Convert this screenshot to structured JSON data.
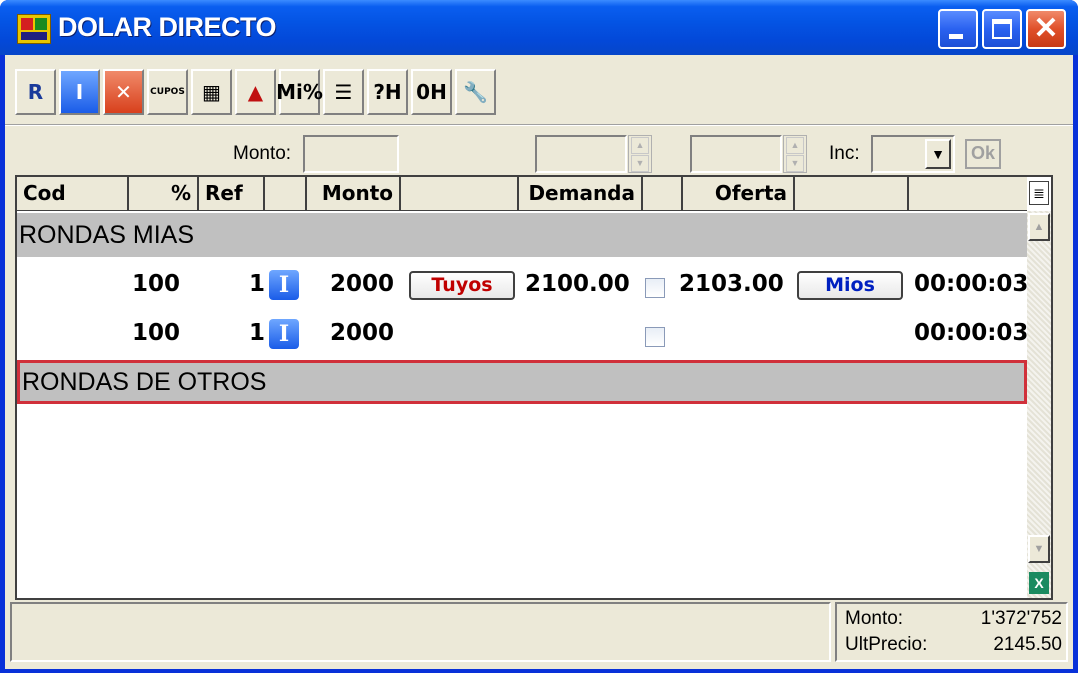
{
  "window": {
    "title": "DOLAR DIRECTO",
    "controls": {
      "minimize": "minimize-icon",
      "maximize": "maximize-icon",
      "close": "close-icon"
    }
  },
  "toolbar": {
    "buttons": [
      {
        "name": "tool-new-round-button",
        "icon": "new-round-icon",
        "glyph": "R",
        "color": "#1a3a9a"
      },
      {
        "name": "tool-info-button",
        "icon": "info-icon",
        "glyph": "I",
        "color": "#ffffff"
      },
      {
        "name": "tool-cancel-button",
        "icon": "cancel-icon",
        "glyph": "✕",
        "color": "#ffffff"
      },
      {
        "name": "tool-cupos-button",
        "icon": "cupos-icon",
        "glyph": "CUPOS",
        "color": "#000000"
      },
      {
        "name": "tool-tables-button",
        "icon": "tables-icon",
        "glyph": "▦",
        "color": "#000000"
      },
      {
        "name": "tool-chart-button",
        "icon": "chart-icon",
        "glyph": "▲",
        "color": "#c01010"
      },
      {
        "name": "tool-mi-percent-button",
        "icon": "mi-percent-icon",
        "glyph": "Mi%",
        "color": "#000000"
      },
      {
        "name": "tool-list-button",
        "icon": "list-icon",
        "glyph": "☰",
        "color": "#000000"
      },
      {
        "name": "tool-help-h-button",
        "icon": "help-h-icon",
        "glyph": "?H",
        "color": "#000000"
      },
      {
        "name": "tool-zero-h-button",
        "icon": "zero-h-icon",
        "glyph": "0H",
        "color": "#000000"
      },
      {
        "name": "tool-settings-button",
        "icon": "wrench-icon",
        "glyph": "🔧",
        "color": "#000000"
      }
    ]
  },
  "inputs": {
    "monto_label": "Monto:",
    "monto_value": "",
    "demanda_value": "",
    "oferta_value": "",
    "inc_label": "Inc:",
    "inc_value": "",
    "ok_label": "Ok"
  },
  "columns": [
    "Cod",
    "%",
    "Ref",
    "",
    "Monto",
    "",
    "Demanda",
    "",
    "Oferta",
    "",
    ""
  ],
  "sections": {
    "mias": "RONDAS MIAS",
    "otros": "RONDAS DE OTROS"
  },
  "rows_mias": [
    {
      "pct": "100",
      "ref": "1",
      "icon": "I",
      "monto": "2000",
      "btn_left": "Tuyos",
      "demanda": "2100.00",
      "checked": false,
      "oferta": "2103.00",
      "btn_right": "Mios",
      "time": "00:00:03"
    },
    {
      "pct": "100",
      "ref": "1",
      "icon": "I",
      "monto": "2000",
      "btn_left": "",
      "demanda": "",
      "checked": false,
      "oferta": "",
      "btn_right": "",
      "time": "00:00:03"
    }
  ],
  "status": {
    "monto_label": "Monto:",
    "monto_value": "1'372'752",
    "ultprecio_label": "UltPrecio:",
    "ultprecio_value": "2145.50"
  },
  "colors": {
    "tuyos": "#c00000",
    "mios": "#0020c0",
    "selected_border": "#d0303a"
  }
}
